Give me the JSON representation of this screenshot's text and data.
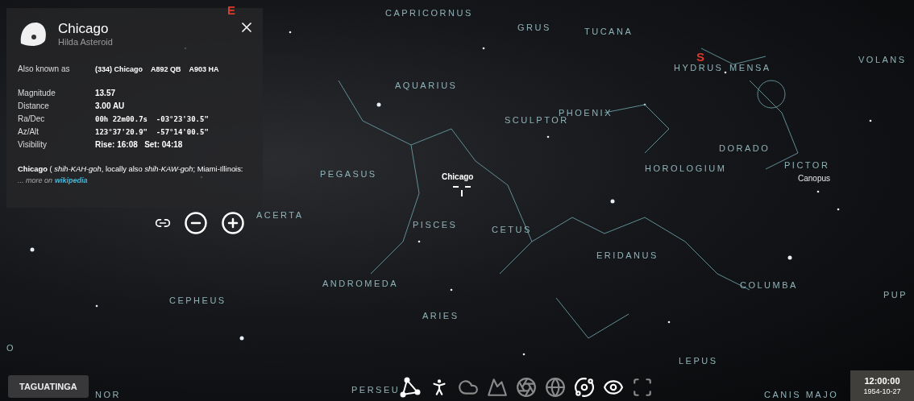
{
  "info_panel": {
    "title": "Chicago",
    "subtitle": "Hilda Asteroid",
    "aliases_label": "Also known as",
    "aliases": [
      "(334) Chicago",
      "A892 QB",
      "A903 HA"
    ],
    "rows": [
      {
        "label": "Magnitude",
        "value": "13.57",
        "mono": false
      },
      {
        "label": "Distance",
        "value": "**3.00** AU",
        "mono": false
      },
      {
        "label": "Ra/Dec",
        "value": "00h 22m00.7s  -03°23'30.5\"",
        "mono": true
      },
      {
        "label": "Az/Alt",
        "value": "123°37'20.9\"  -57°14'00.5\"",
        "mono": true
      },
      {
        "label": "Visibility",
        "value": "Rise: 16:08   Set: 04:18",
        "mono": false
      }
    ],
    "description": "**Chicago** ( *shih-KAH-goh*, locally also *shih-KAW-goh*; Miami-Illinois:",
    "more": "... more on",
    "link": "wikipedia"
  },
  "sky_labels": [
    {
      "text": "E",
      "kind": "cardinal"
    },
    {
      "text": "CAPRICORNUS",
      "kind": "constellation"
    },
    {
      "text": "GRUS",
      "kind": "constellation"
    },
    {
      "text": "TUCANA",
      "kind": "constellation"
    },
    {
      "text": "S",
      "kind": "cardinal"
    },
    {
      "text": "VOLANS",
      "kind": "constellation"
    },
    {
      "text": "HYDRUS",
      "kind": "constellation"
    },
    {
      "text": "MENSA",
      "kind": "constellation"
    },
    {
      "text": "AQUARIUS",
      "kind": "constellation"
    },
    {
      "text": "SCULPTOR",
      "kind": "constellation"
    },
    {
      "text": "PHOENIX",
      "kind": "constellation"
    },
    {
      "text": "DORADO",
      "kind": "constellation"
    },
    {
      "text": "HOROLOGIUM",
      "kind": "constellation"
    },
    {
      "text": "PICTOR",
      "kind": "constellation"
    },
    {
      "text": "Canopus",
      "kind": "star"
    },
    {
      "text": "PEGASUS",
      "kind": "constellation"
    },
    {
      "text": "Chicago",
      "kind": "object"
    },
    {
      "text": "ACERTA",
      "kind": "constellation"
    },
    {
      "text": "PISCES",
      "kind": "constellation"
    },
    {
      "text": "CETUS",
      "kind": "constellation"
    },
    {
      "text": "ERIDANUS",
      "kind": "constellation"
    },
    {
      "text": "ANDROMEDA",
      "kind": "constellation"
    },
    {
      "text": "COLUMBA",
      "kind": "constellation"
    },
    {
      "text": "PUP",
      "kind": "constellation"
    },
    {
      "text": "CEPHEUS",
      "kind": "constellation"
    },
    {
      "text": "ARIES",
      "kind": "constellation"
    },
    {
      "text": "LEPUS",
      "kind": "constellation"
    },
    {
      "text": "CANIS MAJO",
      "kind": "constellation"
    },
    {
      "text": "PERSEU",
      "kind": "constellation"
    },
    {
      "text": "NOR",
      "kind": "constellation"
    },
    {
      "text": "O",
      "kind": "constellation"
    }
  ],
  "location": "TAGUATINGA",
  "time": "12:00:00",
  "date": "1954-10-27",
  "toolbar": [
    {
      "kind": "constellation-lines",
      "selected": true
    },
    {
      "kind": "constellation-art",
      "selected": true
    },
    {
      "kind": "atmosphere",
      "selected": false
    },
    {
      "kind": "landscape",
      "selected": false
    },
    {
      "kind": "azimuthal-grid",
      "selected": false
    },
    {
      "kind": "equatorial-grid",
      "selected": false
    },
    {
      "kind": "milky-way",
      "selected": true
    },
    {
      "kind": "deep-sky",
      "selected": true
    },
    {
      "kind": "fullscreen",
      "selected": false
    }
  ]
}
